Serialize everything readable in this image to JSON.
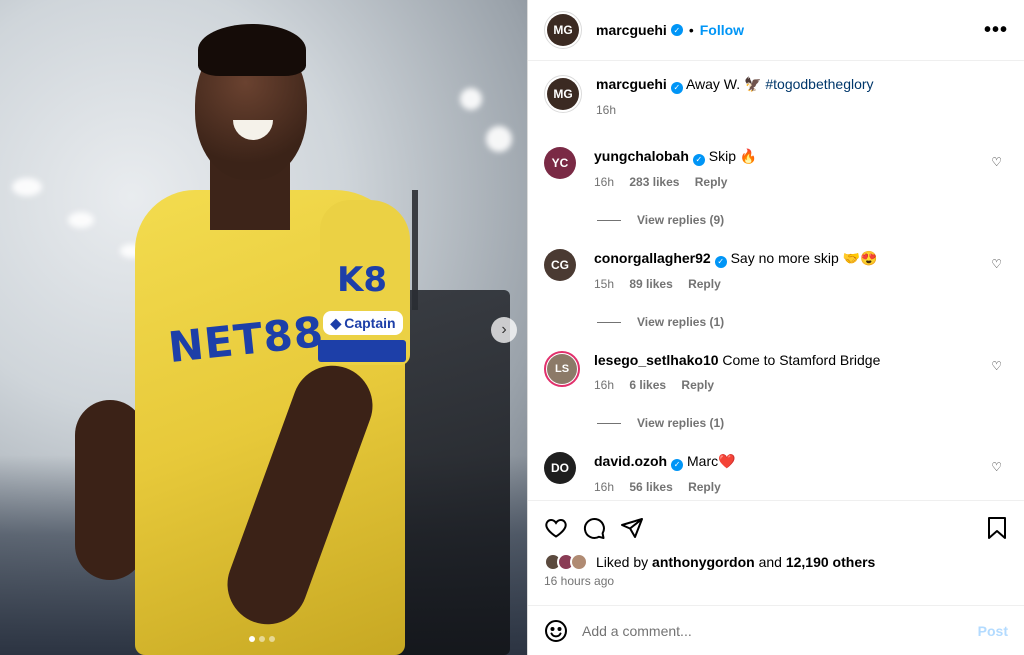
{
  "colors": {
    "accent": "#0095f6",
    "muted": "#737373",
    "hashtag": "#00376b",
    "post_disabled": "#b3dbff"
  },
  "media": {
    "sponsor_text": "NET88",
    "badge_text": "K8",
    "captain_text": "Captain",
    "carousel_total": 3,
    "carousel_active": 1,
    "next_icon": "chevron-right-icon"
  },
  "header": {
    "avatar_initials": "MG",
    "username": "marcguehi",
    "separator": "•",
    "follow_label": "Follow",
    "more_label": "•••"
  },
  "caption": {
    "avatar_initials": "MG",
    "username": "marcguehi",
    "text": "Away W. 🦅",
    "hashtag": "#togodbetheglory",
    "time": "16h"
  },
  "comments": [
    {
      "avatar_initials": "YC",
      "avatar_color": "#7a2a45",
      "username": "yungchalobah",
      "verified": true,
      "text": "Skip 🔥",
      "time": "16h",
      "likes": "283 likes",
      "reply_label": "Reply",
      "view_replies": "View replies (9)"
    },
    {
      "avatar_initials": "CG",
      "avatar_color": "#4a3a32",
      "username": "conorgallagher92",
      "verified": true,
      "text": "Say no more skip 🤝😍",
      "time": "15h",
      "likes": "89 likes",
      "reply_label": "Reply",
      "view_replies": "View replies (1)"
    },
    {
      "avatar_initials": "LS",
      "avatar_color": "#8c7a68",
      "username": "lesego_setlhako10",
      "verified": false,
      "text": "Come to Stamford Bridge",
      "time": "16h",
      "likes": "6 likes",
      "reply_label": "Reply",
      "view_replies": "View replies (1)"
    },
    {
      "avatar_initials": "DO",
      "avatar_color": "#1f1f1f",
      "username": "david.ozoh",
      "verified": true,
      "text": "Marc❤️",
      "time": "16h",
      "likes": "56 likes",
      "reply_label": "Reply"
    }
  ],
  "likes": {
    "prefix": "Liked by",
    "user": "anthonygordon",
    "conjunction": "and",
    "others": "12,190 others",
    "avatars": [
      "#5b4a3e",
      "#8a3c55",
      "#b08b73"
    ]
  },
  "post_time": "16 hours ago",
  "add_comment": {
    "placeholder": "Add a comment...",
    "post_label": "Post"
  }
}
